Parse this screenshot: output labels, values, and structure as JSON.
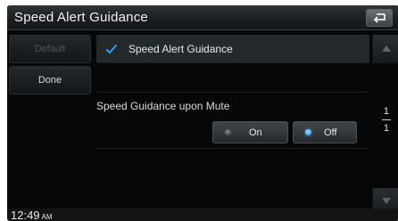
{
  "header": {
    "title": "Speed Alert Guidance",
    "back_icon": "return-arrow-icon"
  },
  "side_buttons": {
    "default_label": "Default",
    "done_label": "Done"
  },
  "options": {
    "speed_alert_guidance": {
      "label": "Speed Alert Guidance",
      "checked": true,
      "icon": "checkmark-icon"
    },
    "speed_guidance_upon_mute": {
      "label": "Speed Guidance upon Mute",
      "on_label": "On",
      "off_label": "Off",
      "selected": "Off"
    }
  },
  "pagination": {
    "current": "1",
    "total": "1"
  },
  "status_bar": {
    "time": "12:49",
    "ampm": "AM"
  },
  "colors": {
    "accent_blue": "#2f8fe0",
    "background": "#050708"
  }
}
